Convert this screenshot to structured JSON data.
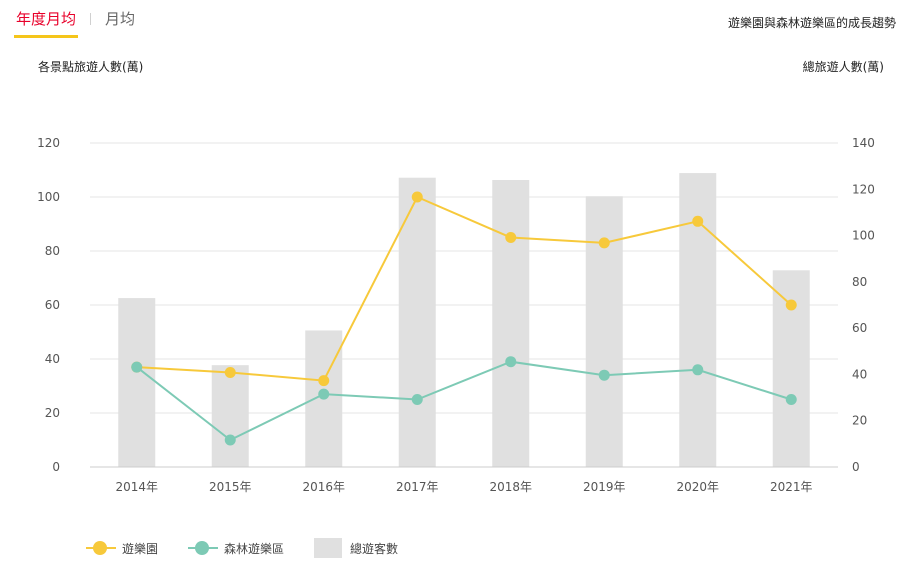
{
  "tabs": [
    {
      "label": "年度月均",
      "active": true
    },
    {
      "label": "月均",
      "active": false
    }
  ],
  "chart_title": "遊樂園與森林遊樂區的成長趨勢",
  "colors": {
    "tab_active": "#e8002a",
    "tab_underline": "#f5c51a",
    "theme_park": "#f7c93b",
    "forest": "#7dcab5",
    "total_bar": "#e0e0e0"
  },
  "chart_data": {
    "type": "bar",
    "categories": [
      "2014年",
      "2015年",
      "2016年",
      "2017年",
      "2018年",
      "2019年",
      "2020年",
      "2021年"
    ],
    "left_axis": {
      "label": "各景點旅遊人數(萬)",
      "ylim": [
        0,
        120
      ],
      "ticks": [
        0,
        20,
        40,
        60,
        80,
        100,
        120
      ]
    },
    "right_axis": {
      "label": "總旅遊人數(萬)",
      "ylim": [
        0,
        140
      ],
      "ticks": [
        0,
        20,
        40,
        60,
        80,
        100,
        120,
        140
      ]
    },
    "series": [
      {
        "name": "遊樂園",
        "type": "line",
        "axis": "left",
        "color": "#f7c93b",
        "values": [
          37,
          35,
          32,
          100,
          85,
          83,
          91,
          60
        ]
      },
      {
        "name": "森林遊樂區",
        "type": "line",
        "axis": "left",
        "color": "#7dcab5",
        "values": [
          37,
          10,
          27,
          25,
          39,
          34,
          36,
          25
        ]
      },
      {
        "name": "總遊客數",
        "type": "bar",
        "axis": "right",
        "color": "#e0e0e0",
        "values": [
          73,
          44,
          59,
          125,
          124,
          117,
          127,
          85
        ]
      }
    ],
    "grid": true,
    "legend_position": "bottom-left"
  }
}
